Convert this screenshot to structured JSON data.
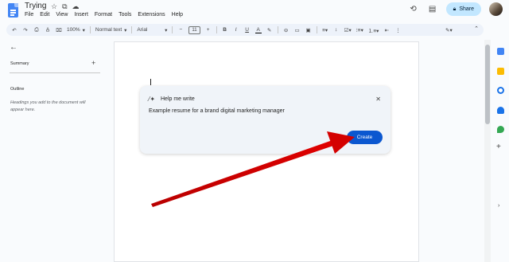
{
  "header": {
    "title": "Trying",
    "title_icons": [
      "star-icon",
      "move-folder-icon",
      "cloud-status-icon"
    ],
    "menu": [
      "File",
      "Edit",
      "View",
      "Insert",
      "Format",
      "Tools",
      "Extensions",
      "Help"
    ],
    "share_label": "Share",
    "right_icons": [
      "history-icon",
      "comment-icon"
    ]
  },
  "toolbar": {
    "zoom": "100%",
    "style": "Normal text",
    "font": "Arial",
    "font_size": "11"
  },
  "left_panel": {
    "summary_label": "Summary",
    "outline_label": "Outline",
    "outline_hint": "Headings you add to the document will appear here."
  },
  "help_me_write": {
    "title": "Help me write",
    "prompt": "Example resume for a brand digital marketing manager",
    "create_label": "Create"
  },
  "colors": {
    "accent": "#0b57d0",
    "share_bg": "#c2e7ff",
    "arrow": "#d40000"
  }
}
